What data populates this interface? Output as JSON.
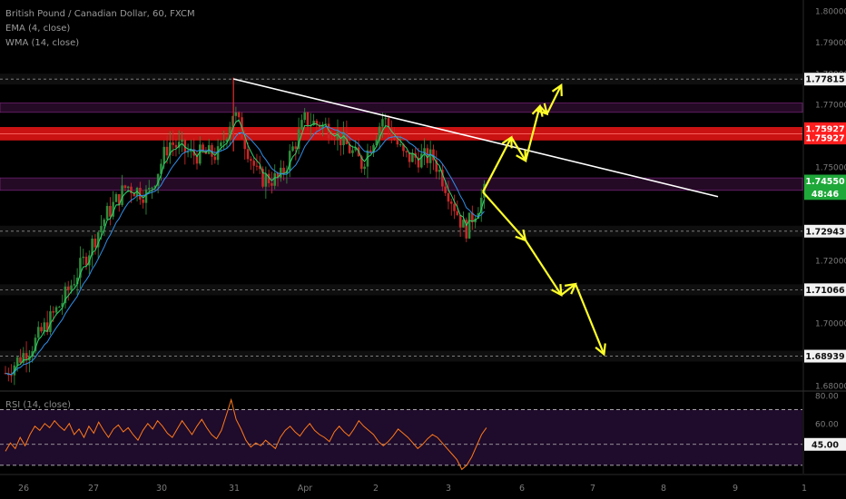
{
  "legend": {
    "title": "British Pound / Canadian Dollar, 60, FXCM",
    "ema": "EMA (4, close)",
    "wma": "WMA (14, close)",
    "rsi": "RSI (14, close)"
  },
  "colors": {
    "background": "#000000",
    "up_candle": "#2e8b3a",
    "down_candle": "#c62828",
    "ema": "#2dd46e",
    "wma": "#2f8fe8",
    "trendline": "#ffffff",
    "arrows": "#ffff2a",
    "resistance_band": "#e01414",
    "zone": "#6a1c6e",
    "rsi_line": "#ff7a1a",
    "label_red": "#ff1e1e",
    "label_green": "#1fa83a",
    "label_white": "#f2f2f2"
  },
  "chart_data": {
    "type": "candlestick",
    "title": "British Pound / Canadian Dollar, 60, FXCM",
    "timeframe": "60",
    "indicators": [
      "EMA (4, close)",
      "WMA (14, close)"
    ],
    "x_ticks": [
      "26",
      "27",
      "30",
      "31",
      "Apr",
      "2",
      "3",
      "6",
      "7",
      "8",
      "9",
      "1"
    ],
    "y_ticks": [
      "1.80000",
      "1.79000",
      "1.78000",
      "1.77000",
      "1.75000",
      "1.73000",
      "1.72000",
      "1.70000",
      "1.69000",
      "1.68000"
    ],
    "ylim": [
      1.6785,
      1.8035
    ],
    "price_labels": [
      {
        "text": "1.77815",
        "value": 1.77815,
        "style": "white"
      },
      {
        "text": "1.75927",
        "value": 1.76227,
        "style": "red"
      },
      {
        "text": "1.75927",
        "value": 1.75927,
        "style": "red"
      },
      {
        "text": "1.74550",
        "value": 1.7455,
        "style": "green"
      },
      {
        "text": "48:46",
        "value": 1.7415,
        "style": "green"
      },
      {
        "text": "1.72943",
        "value": 1.72943,
        "style": "white"
      },
      {
        "text": "1.71066",
        "value": 1.71066,
        "style": "white"
      },
      {
        "text": "1.68939",
        "value": 1.68939,
        "style": "white"
      }
    ],
    "price_path": [
      {
        "x": 0.0,
        "y": 1.684
      },
      {
        "x": 0.4,
        "y": 1.6935
      },
      {
        "x": 0.8,
        "y": 1.707
      },
      {
        "x": 1.1,
        "y": 1.72
      },
      {
        "x": 1.4,
        "y": 1.734
      },
      {
        "x": 1.7,
        "y": 1.744
      },
      {
        "x": 2.0,
        "y": 1.741
      },
      {
        "x": 2.3,
        "y": 1.758
      },
      {
        "x": 2.6,
        "y": 1.754
      },
      {
        "x": 3.0,
        "y": 1.754
      },
      {
        "x": 3.2,
        "y": 1.768
      },
      {
        "x": 3.55,
        "y": 1.7465
      },
      {
        "x": 3.85,
        "y": 1.746
      },
      {
        "x": 4.2,
        "y": 1.765
      },
      {
        "x": 4.6,
        "y": 1.762
      },
      {
        "x": 5.0,
        "y": 1.751
      },
      {
        "x": 5.3,
        "y": 1.766
      },
      {
        "x": 5.6,
        "y": 1.753
      },
      {
        "x": 6.0,
        "y": 1.753
      },
      {
        "x": 6.2,
        "y": 1.743
      },
      {
        "x": 6.45,
        "y": 1.7294
      },
      {
        "x": 6.75,
        "y": 1.743
      }
    ],
    "trendline": {
      "from": {
        "x": 3.2,
        "y": 1.7782
      },
      "to": {
        "x": 10.0,
        "y": 1.7405
      }
    },
    "horizontal_levels": [
      1.77815,
      1.72943,
      1.71066,
      1.68939
    ],
    "resistance_band": [
      1.7585,
      1.7628
    ],
    "zones": [
      [
        1.7675,
        1.7705
      ],
      [
        1.7425,
        1.7465
      ]
    ],
    "projection_up": [
      {
        "x": 6.7,
        "y": 1.742
      },
      {
        "x": 7.1,
        "y": 1.7595
      },
      {
        "x": 7.3,
        "y": 1.752
      },
      {
        "x": 7.5,
        "y": 1.7695
      },
      {
        "x": 7.6,
        "y": 1.767
      },
      {
        "x": 7.8,
        "y": 1.7762
      }
    ],
    "projection_down": [
      {
        "x": 6.7,
        "y": 1.742
      },
      {
        "x": 7.3,
        "y": 1.7265
      },
      {
        "x": 7.8,
        "y": 1.709
      },
      {
        "x": 8.0,
        "y": 1.7125
      },
      {
        "x": 8.4,
        "y": 1.69
      }
    ],
    "rsi": {
      "label": "RSI (14, close)",
      "ticks": [
        "80.00",
        "60.00",
        "45.00"
      ],
      "ylim": [
        24,
        82
      ],
      "levels": [
        70,
        45,
        30
      ],
      "current_label": "45.00",
      "values": [
        40,
        46,
        42,
        50,
        44,
        52,
        58,
        55,
        60,
        57,
        62,
        58,
        55,
        60,
        52,
        56,
        50,
        58,
        53,
        61,
        55,
        50,
        56,
        59,
        54,
        57,
        52,
        48,
        55,
        60,
        56,
        62,
        58,
        53,
        50,
        56,
        62,
        57,
        52,
        58,
        63,
        57,
        52,
        49,
        55,
        66,
        77,
        63,
        56,
        48,
        43,
        46,
        44,
        48,
        45,
        42,
        50,
        55,
        58,
        54,
        51,
        56,
        60,
        55,
        52,
        50,
        47,
        54,
        58,
        54,
        51,
        56,
        62,
        58,
        55,
        52,
        47,
        44,
        47,
        51,
        56,
        53,
        50,
        46,
        42,
        45,
        49,
        52,
        50,
        46,
        42,
        38,
        34,
        27,
        30,
        36,
        44,
        52,
        57
      ]
    }
  }
}
